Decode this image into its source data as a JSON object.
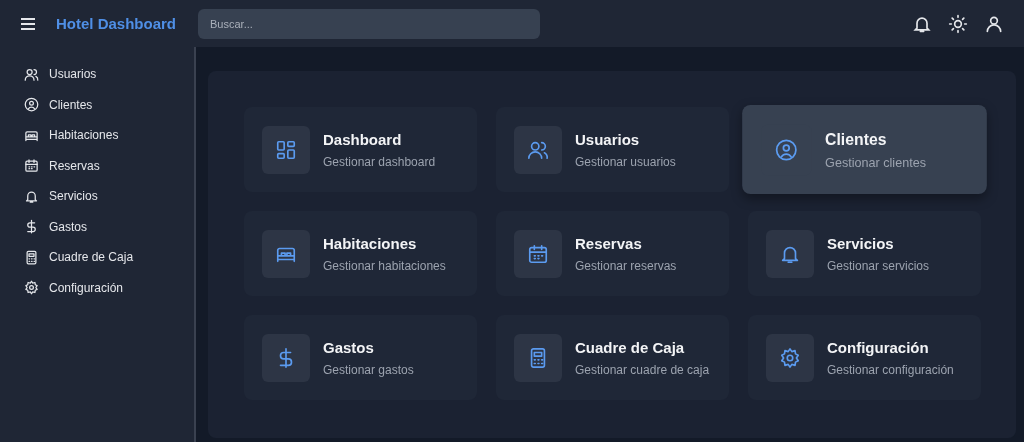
{
  "header": {
    "title": "Hotel Dashboard",
    "search": {
      "placeholder": "Buscar..."
    }
  },
  "sidebar": {
    "items": [
      {
        "label": "Usuarios",
        "kind": "users"
      },
      {
        "label": "Clientes",
        "kind": "user-circle"
      },
      {
        "label": "Habitaciones",
        "kind": "bed"
      },
      {
        "label": "Reservas",
        "kind": "calendar"
      },
      {
        "label": "Servicios",
        "kind": "bell"
      },
      {
        "label": "Gastos",
        "kind": "dollar"
      },
      {
        "label": "Cuadre de Caja",
        "kind": "calculator"
      },
      {
        "label": "Configuración",
        "kind": "gear"
      }
    ]
  },
  "cards": [
    {
      "title": "Dashboard",
      "subtitle": "Gestionar dashboard",
      "kind": "grid",
      "selected": false
    },
    {
      "title": "Usuarios",
      "subtitle": "Gestionar usuarios",
      "kind": "users",
      "selected": false
    },
    {
      "title": "Clientes",
      "subtitle": "Gestionar clientes",
      "kind": "user-circle",
      "selected": true
    },
    {
      "title": "Habitaciones",
      "subtitle": "Gestionar habitaciones",
      "kind": "bed",
      "selected": false
    },
    {
      "title": "Reservas",
      "subtitle": "Gestionar reservas",
      "kind": "calendar",
      "selected": false
    },
    {
      "title": "Servicios",
      "subtitle": "Gestionar servicios",
      "kind": "bell",
      "selected": false
    },
    {
      "title": "Gastos",
      "subtitle": "Gestionar gastos",
      "kind": "dollar",
      "selected": false
    },
    {
      "title": "Cuadre de Caja",
      "subtitle": "Gestionar cuadre de caja",
      "kind": "calculator",
      "selected": false
    },
    {
      "title": "Configuración",
      "subtitle": "Gestionar configuración",
      "kind": "gear",
      "selected": false
    }
  ]
}
